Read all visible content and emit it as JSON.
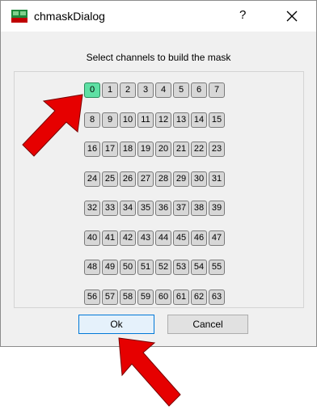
{
  "window": {
    "title": "chmaskDialog",
    "help_label": "?",
    "icon": "cern-app-icon"
  },
  "prompt": "Select channels to build the mask",
  "channels": [
    {
      "label": "0",
      "on": true
    },
    {
      "label": "1",
      "on": false
    },
    {
      "label": "2",
      "on": false
    },
    {
      "label": "3",
      "on": false
    },
    {
      "label": "4",
      "on": false
    },
    {
      "label": "5",
      "on": false
    },
    {
      "label": "6",
      "on": false
    },
    {
      "label": "7",
      "on": false
    },
    {
      "label": "8",
      "on": false
    },
    {
      "label": "9",
      "on": false
    },
    {
      "label": "10",
      "on": false
    },
    {
      "label": "11",
      "on": false
    },
    {
      "label": "12",
      "on": false
    },
    {
      "label": "13",
      "on": false
    },
    {
      "label": "14",
      "on": false
    },
    {
      "label": "15",
      "on": false
    },
    {
      "label": "16",
      "on": false
    },
    {
      "label": "17",
      "on": false
    },
    {
      "label": "18",
      "on": false
    },
    {
      "label": "19",
      "on": false
    },
    {
      "label": "20",
      "on": false
    },
    {
      "label": "21",
      "on": false
    },
    {
      "label": "22",
      "on": false
    },
    {
      "label": "23",
      "on": false
    },
    {
      "label": "24",
      "on": false
    },
    {
      "label": "25",
      "on": false
    },
    {
      "label": "26",
      "on": false
    },
    {
      "label": "27",
      "on": false
    },
    {
      "label": "28",
      "on": false
    },
    {
      "label": "29",
      "on": false
    },
    {
      "label": "30",
      "on": false
    },
    {
      "label": "31",
      "on": false
    },
    {
      "label": "32",
      "on": false
    },
    {
      "label": "33",
      "on": false
    },
    {
      "label": "34",
      "on": false
    },
    {
      "label": "35",
      "on": false
    },
    {
      "label": "36",
      "on": false
    },
    {
      "label": "37",
      "on": false
    },
    {
      "label": "38",
      "on": false
    },
    {
      "label": "39",
      "on": false
    },
    {
      "label": "40",
      "on": false
    },
    {
      "label": "41",
      "on": false
    },
    {
      "label": "42",
      "on": false
    },
    {
      "label": "43",
      "on": false
    },
    {
      "label": "44",
      "on": false
    },
    {
      "label": "45",
      "on": false
    },
    {
      "label": "46",
      "on": false
    },
    {
      "label": "47",
      "on": false
    },
    {
      "label": "48",
      "on": false
    },
    {
      "label": "49",
      "on": false
    },
    {
      "label": "50",
      "on": false
    },
    {
      "label": "51",
      "on": false
    },
    {
      "label": "52",
      "on": false
    },
    {
      "label": "53",
      "on": false
    },
    {
      "label": "54",
      "on": false
    },
    {
      "label": "55",
      "on": false
    },
    {
      "label": "56",
      "on": false
    },
    {
      "label": "57",
      "on": false
    },
    {
      "label": "58",
      "on": false
    },
    {
      "label": "59",
      "on": false
    },
    {
      "label": "60",
      "on": false
    },
    {
      "label": "61",
      "on": false
    },
    {
      "label": "62",
      "on": false
    },
    {
      "label": "63",
      "on": false
    }
  ],
  "buttons": {
    "ok_label": "Ok",
    "cancel_label": "Cancel"
  },
  "colors": {
    "selected_channel": "#5ee0a4",
    "channel": "#d7d7d7",
    "annotation_arrow": "#e60000"
  },
  "icons": [
    "cern-app-icon",
    "close-icon",
    "red-arrow-icon"
  ]
}
